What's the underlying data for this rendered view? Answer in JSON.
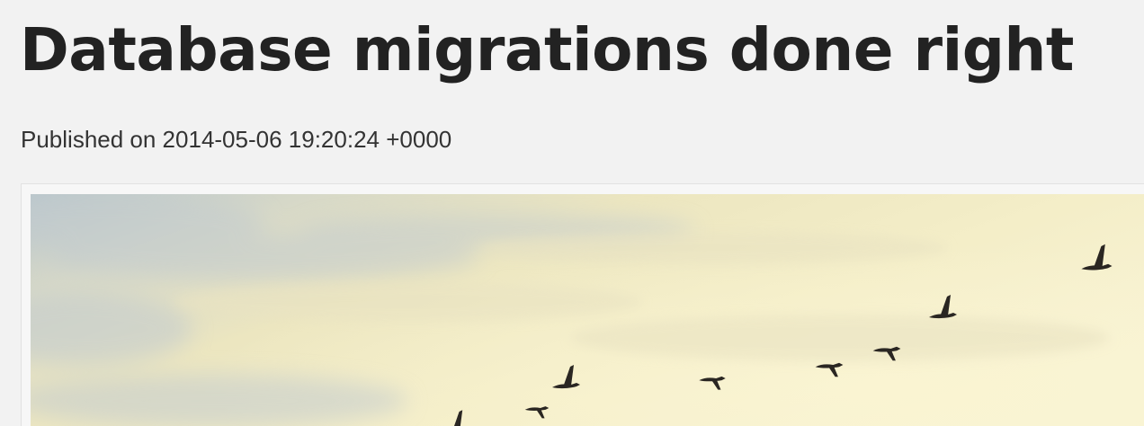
{
  "post": {
    "title": "Database migrations done right",
    "meta": "Published on 2014-05-06 19:20:24 +0000"
  },
  "hero_image": {
    "subject": "geese-flock-flying-at-dusk",
    "colors": {
      "sky_top_left": "#c4cdd0",
      "sky_warm": "#f0e9c0",
      "sky_light": "#f7f3d6",
      "bird": "#2a2622"
    }
  }
}
